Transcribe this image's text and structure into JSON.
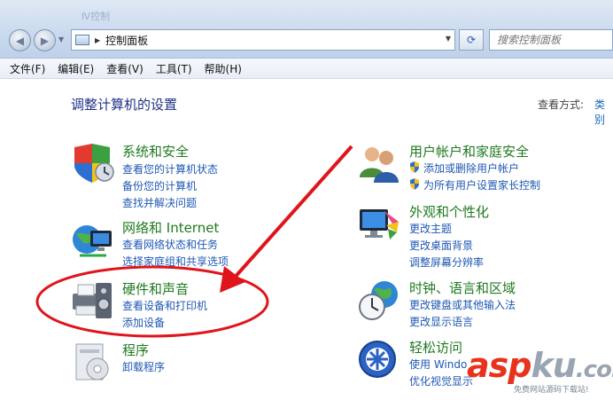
{
  "window": {
    "faint_title": "Ⅳ控制"
  },
  "address_bar": {
    "crumb": "控制面板",
    "search_placeholder": "搜索控制面板"
  },
  "menu": {
    "items": [
      "文件(F)",
      "编辑(E)",
      "查看(V)",
      "工具(T)",
      "帮助(H)"
    ]
  },
  "page": {
    "heading": "调整计算机的设置",
    "view_by_label": "查看方式:",
    "view_by_value": "类别"
  },
  "categories": {
    "system_security": {
      "title": "系统和安全",
      "links": [
        "查看您的计算机状态",
        "备份您的计算机",
        "查找并解决问题"
      ]
    },
    "network": {
      "title": "网络和 Internet",
      "links": [
        "查看网络状态和任务",
        "选择家庭组和共享选项"
      ]
    },
    "hardware": {
      "title": "硬件和声音",
      "links": [
        "查看设备和打印机",
        "添加设备"
      ]
    },
    "programs": {
      "title": "程序",
      "links": [
        "卸载程序"
      ]
    },
    "user_accounts": {
      "title": "用户帐户和家庭安全",
      "links": [
        "添加或删除用户帐户",
        "为所有用户设置家长控制"
      ]
    },
    "appearance": {
      "title": "外观和个性化",
      "links": [
        "更改主题",
        "更改桌面背景",
        "调整屏幕分辨率"
      ]
    },
    "clock": {
      "title": "时钟、语言和区域",
      "links": [
        "更改键盘或其他输入法",
        "更改显示语言"
      ]
    },
    "ease": {
      "title": "轻松访问",
      "links": [
        "使用 Windo",
        "优化视觉显示"
      ]
    }
  },
  "watermark": {
    "brand_red": "asp",
    "brand_gray": "ku",
    "brand_suffix": ".com",
    "tagline": "免费网站源码下载站!"
  },
  "colors": {
    "annotation": "#e0151b",
    "category_title": "#1f7a1f",
    "link": "#1f58b3",
    "heading": "#1e3287"
  }
}
